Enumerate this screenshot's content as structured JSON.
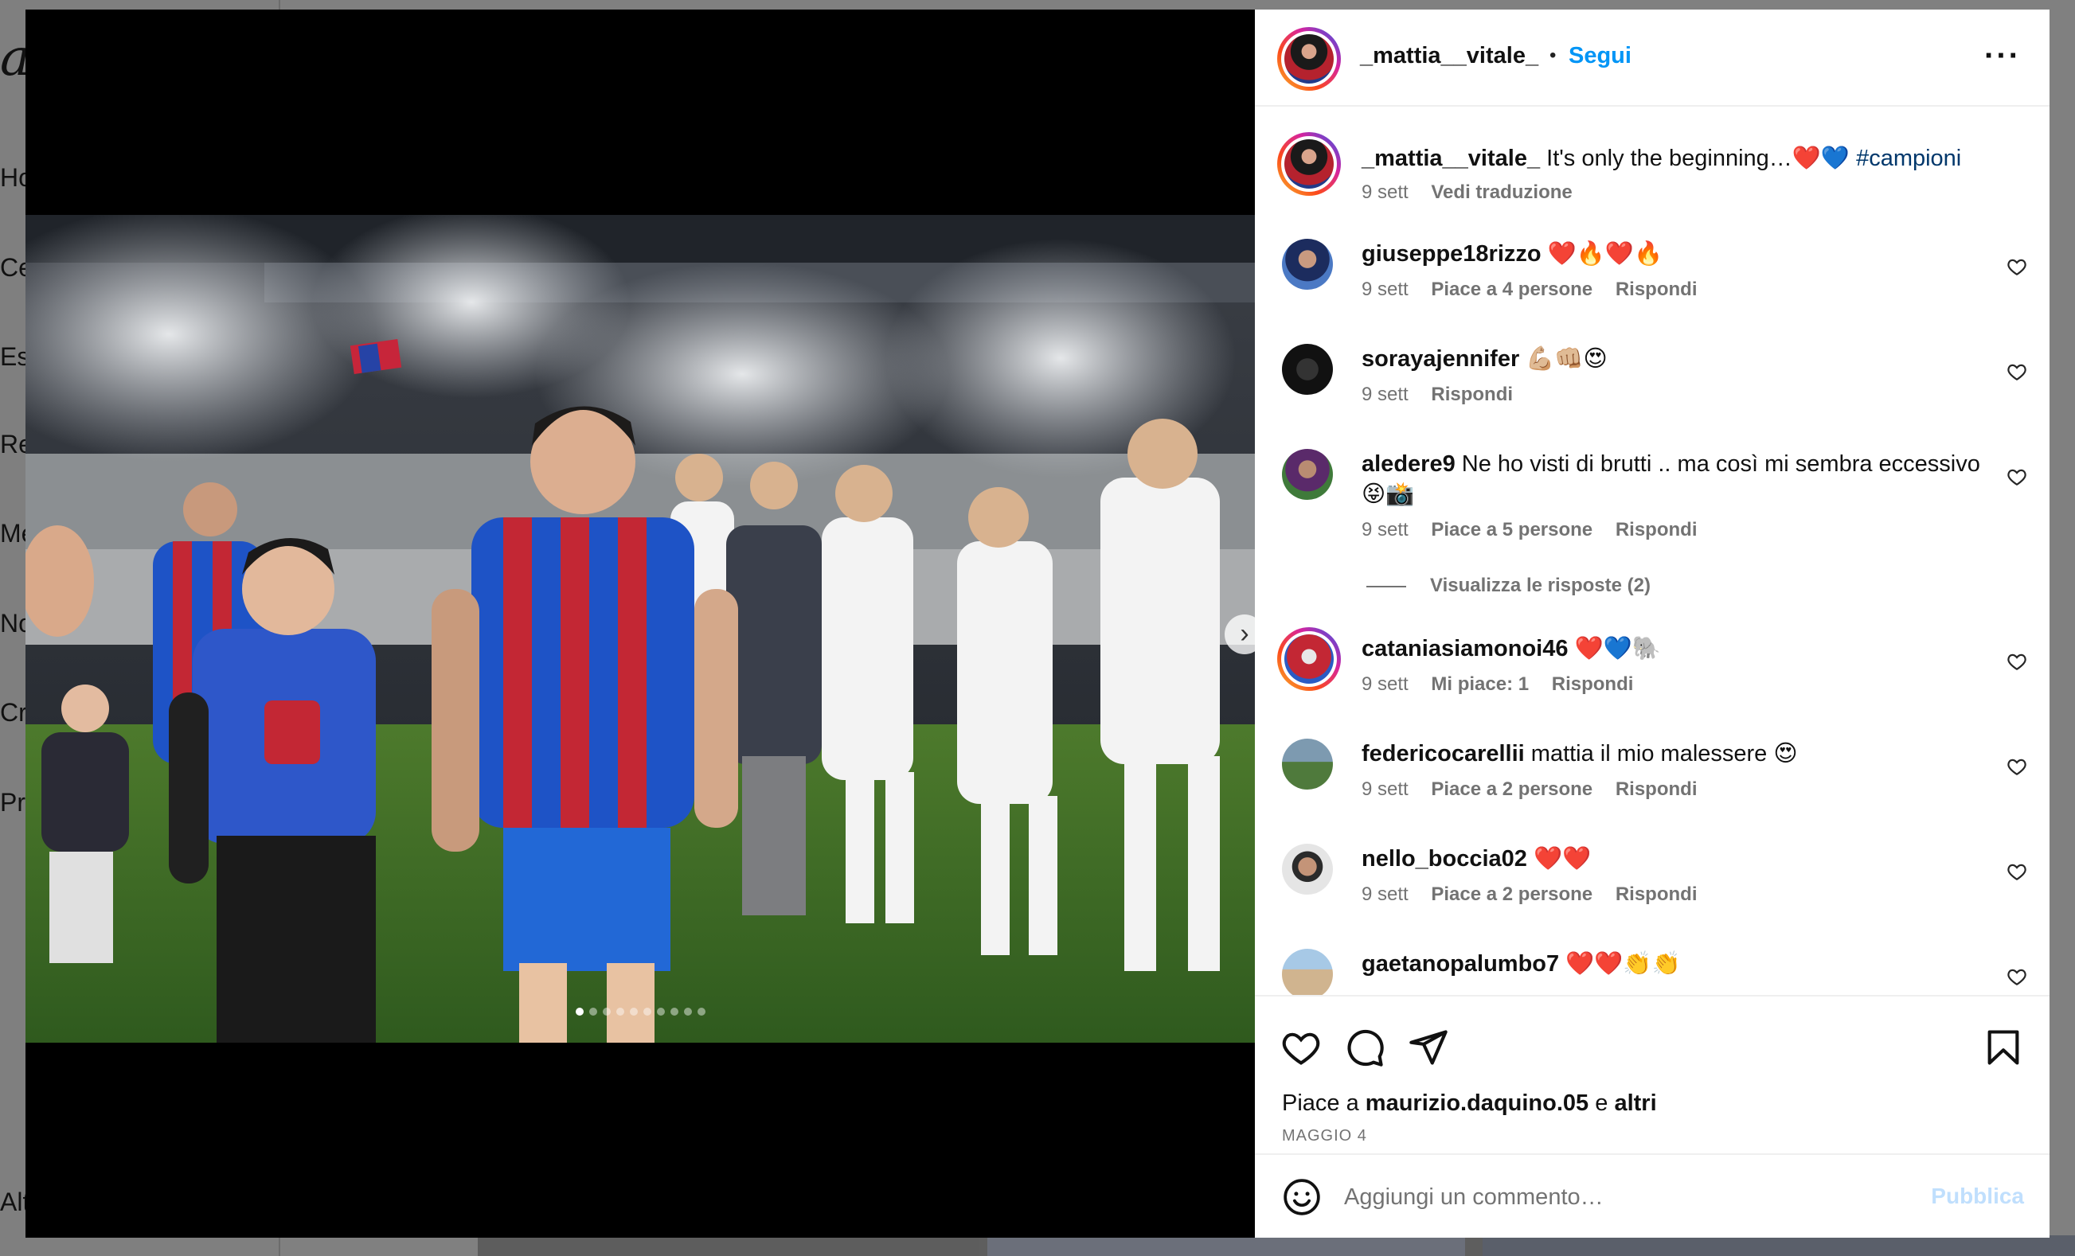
{
  "background": {
    "logo_fragment": "ag",
    "nav": [
      "Ho",
      "Ce",
      "Esp",
      "Re",
      "Me",
      "No",
      "Cre",
      "Pro",
      "Alt"
    ]
  },
  "media": {
    "next_icon": "chevron-right-icon",
    "dot_count": 10,
    "active_dot": 0
  },
  "post": {
    "author": "_mattia__vitale_",
    "separator": "•",
    "follow_label": "Segui",
    "more_icon": "more-horizontal-icon",
    "caption": {
      "user": "_mattia__vitale_",
      "text": "It's only the beginning…❤️💙",
      "hashtag": "#campioni",
      "time": "9 sett",
      "translate": "Vedi traduzione"
    },
    "comments": [
      {
        "user": "giuseppe18rizzo",
        "text": "❤️🔥❤️🔥",
        "time": "9 sett",
        "likes": "Piace a 4 persone",
        "reply": "Rispondi"
      },
      {
        "user": "sorayajennifer",
        "text": "💪🏼👊🏼😍",
        "time": "9 sett",
        "likes": "",
        "reply": "Rispondi"
      },
      {
        "user": "aledere9",
        "text": "Ne ho visti di brutti .. ma così mi sembra eccessivo 😝📸",
        "time": "9 sett",
        "likes": "Piace a 5 persone",
        "reply": "Rispondi",
        "view_replies": "Visualizza le risposte (2)"
      },
      {
        "user": "cataniasiamonoi46",
        "text": "❤️💙🐘",
        "time": "9 sett",
        "likes": "Mi piace: 1",
        "reply": "Rispondi"
      },
      {
        "user": "federicocarellii",
        "text": "mattia il mio malessere 😍",
        "time": "9 sett",
        "likes": "Piace a 2 persone",
        "reply": "Rispondi"
      },
      {
        "user": "nello_boccia02",
        "text": "❤️❤️",
        "time": "9 sett",
        "likes": "Piace a 2 persone",
        "reply": "Rispondi"
      },
      {
        "user": "gaetanopalumbo7",
        "text": "❤️❤️👏👏",
        "time": "",
        "likes": "",
        "reply": ""
      }
    ],
    "actions": {
      "like_icon": "heart-icon",
      "comment_icon": "comment-icon",
      "share_icon": "send-icon",
      "save_icon": "bookmark-icon"
    },
    "likes_prefix": "Piace a",
    "likes_user": "maurizio.daquino.05",
    "likes_mid": "e",
    "likes_suffix": "altri",
    "date": "MAGGIO 4",
    "composer": {
      "emoji_icon": "emoji-icon",
      "placeholder": "Aggiungi un commento…",
      "publish_label": "Pubblica"
    }
  }
}
